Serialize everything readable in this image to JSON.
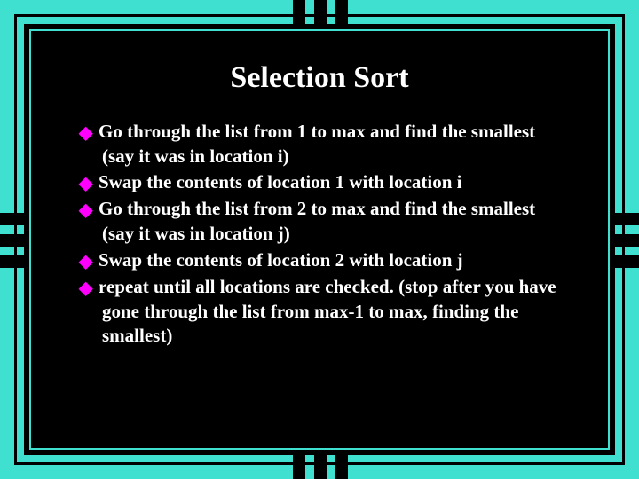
{
  "title": "Selection Sort",
  "bullets": [
    "Go through the list from 1 to max and find the smallest (say it was in location i)",
    "Swap the contents of location 1 with location i",
    "Go through the list from 2 to max and find the smallest (say it was in location j)",
    "Swap the contents of location 2 with location j",
    "repeat until all locations are checked. (stop after you have gone through the list from max-1 to max, finding the smallest)"
  ],
  "colors": {
    "background": "#40E0D0",
    "bullet": "#FF00FF",
    "text": "#FFFFFF",
    "frame": "#000000"
  }
}
